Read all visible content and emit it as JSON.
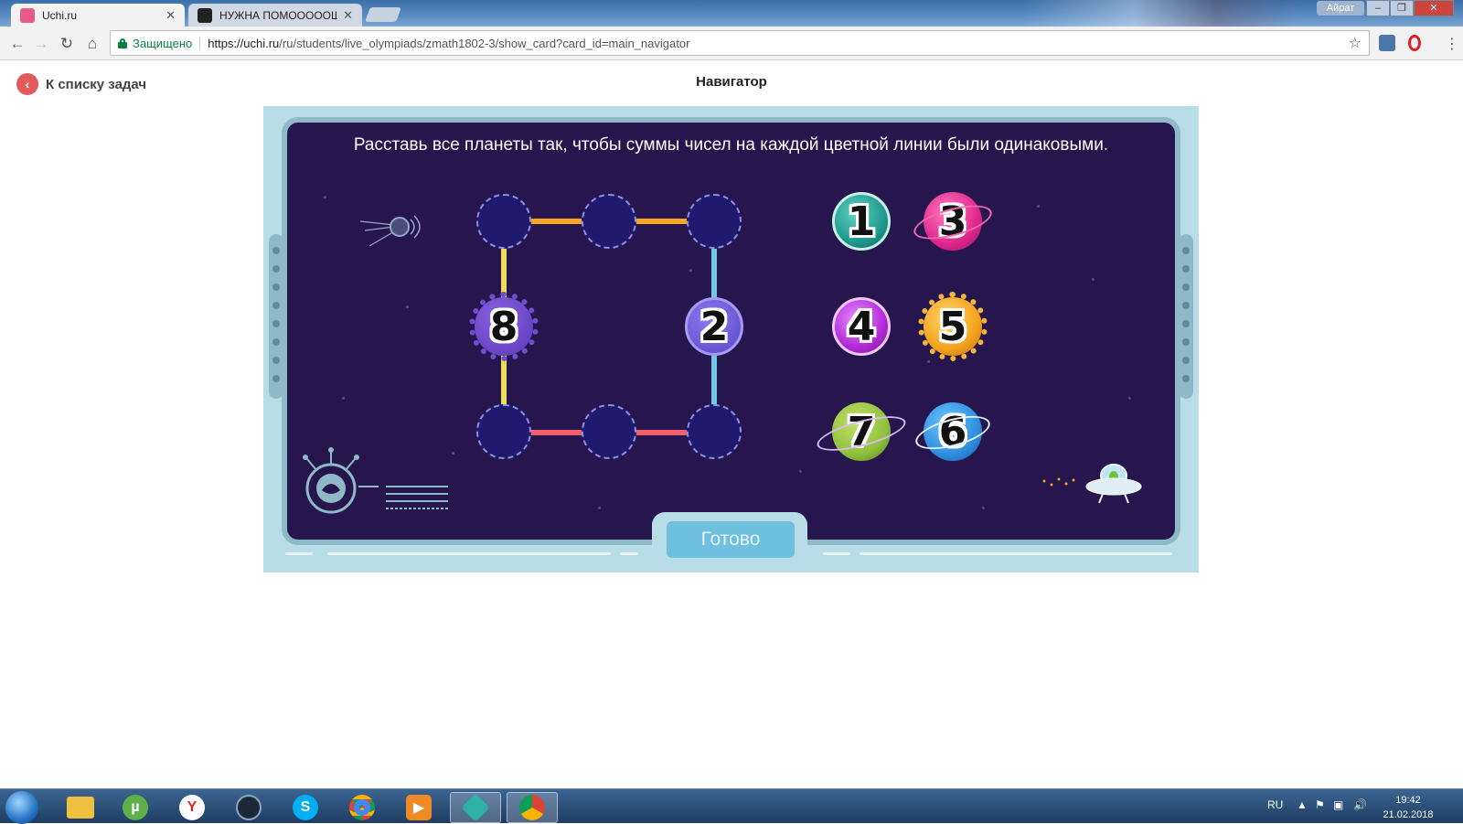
{
  "browser": {
    "tabs": [
      {
        "title": "Uchi.ru",
        "active": true
      },
      {
        "title": "НУЖНА ПОМОООООЩЬ",
        "active": false
      }
    ],
    "user_badge": "Айрат",
    "secure_label": "Защищено",
    "url_host": "https://uchi.ru",
    "url_path": "/ru/students/live_olympiads/zmath1802-3/show_card?card_id=main_navigator"
  },
  "page": {
    "back_label": "К списку задач",
    "title": "Навигатор"
  },
  "game": {
    "instruction": "Расставь все планеты так, чтобы суммы чисел на каждой цветной линии были одинаковыми.",
    "done_label": "Готово",
    "line_colors": {
      "top": "#f5a623",
      "left": "#e8e05a",
      "right": "#6fc8e6",
      "bottom": "#ef5f6e"
    },
    "placed": [
      {
        "value": "8",
        "slot": "left-middle"
      },
      {
        "value": "2",
        "slot": "right-middle"
      }
    ],
    "tray_planets": [
      {
        "value": "1",
        "color": "#1f9a8e"
      },
      {
        "value": "3",
        "color": "#e0268e"
      },
      {
        "value": "4",
        "color": "#b52ad8"
      },
      {
        "value": "5",
        "color": "#f4a31c"
      },
      {
        "value": "7",
        "color": "#8fc23c"
      },
      {
        "value": "6",
        "color": "#2f8fe0"
      }
    ]
  },
  "taskbar": {
    "language": "RU",
    "time": "19:42",
    "date": "21.02.2018"
  }
}
